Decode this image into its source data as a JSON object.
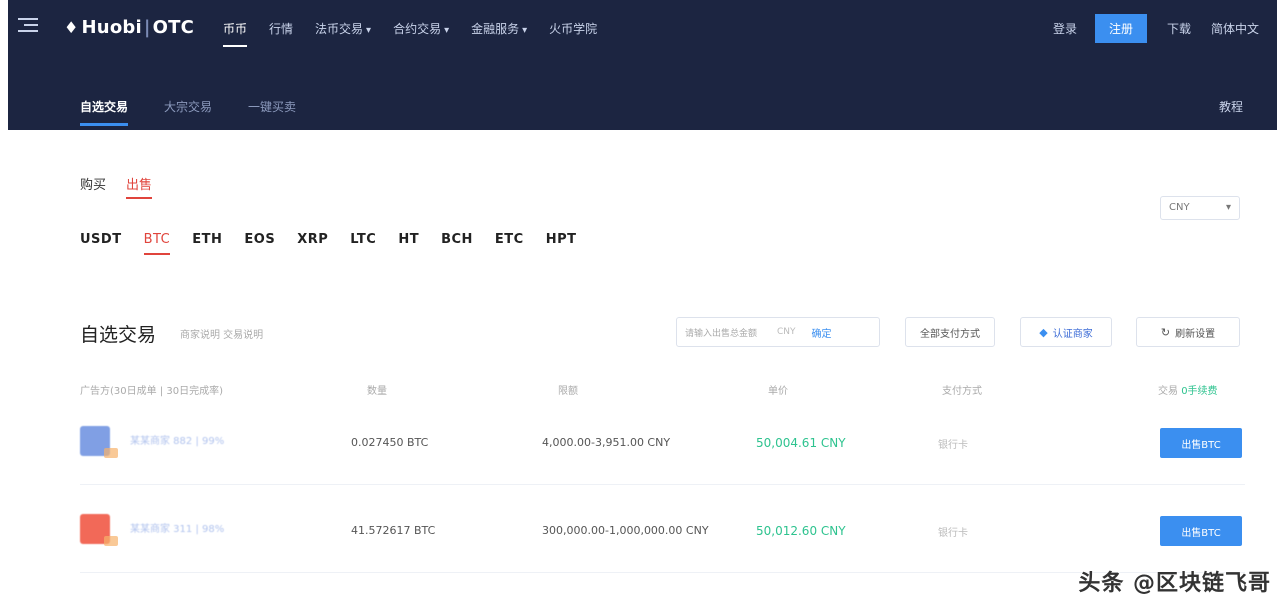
{
  "header": {
    "logo_main": "Huobi",
    "logo_sep": "|",
    "logo_sub": "OTC",
    "nav": [
      {
        "label": "币币",
        "caret": false,
        "active": true
      },
      {
        "label": "行情",
        "caret": false,
        "active": false
      },
      {
        "label": "法币交易",
        "caret": true,
        "active": false
      },
      {
        "label": "合约交易",
        "caret": true,
        "active": false
      },
      {
        "label": "金融服务",
        "caret": true,
        "active": false
      },
      {
        "label": "火币学院",
        "caret": false,
        "active": false
      }
    ],
    "login": "登录",
    "register": "注册",
    "download": "下载",
    "language": "简体中文",
    "subnav": [
      {
        "label": "自选交易",
        "active": true
      },
      {
        "label": "大宗交易",
        "active": false
      },
      {
        "label": "一键买卖",
        "active": false
      }
    ],
    "tutorial": "教程"
  },
  "side_tabs": [
    "购买",
    "出售"
  ],
  "active_side": 1,
  "coins": [
    "USDT",
    "BTC",
    "ETH",
    "EOS",
    "XRP",
    "LTC",
    "HT",
    "BCH",
    "ETC",
    "HPT"
  ],
  "active_coin": 1,
  "currency_select": {
    "value": "CNY",
    "caret": "▾"
  },
  "section": {
    "title": "自选交易",
    "subtitle": "商家说明  交易说明",
    "amount_placeholder": "请输入出售总金额",
    "amount_unit": "CNY",
    "amount_confirm": "确定",
    "payment_filter": "全部支付方式",
    "merchant_filter": "认证商家",
    "refresh": "刷新设置"
  },
  "table": {
    "headers": {
      "merchant": "广告方(30日成单 | 30日完成率)",
      "quantity": "数量",
      "limit": "限额",
      "price": "单价",
      "payment": "支付方式",
      "action": "交易",
      "action_hint": "0手续费"
    },
    "rows": [
      {
        "merchant": "某某商家 882 | 99%",
        "quantity": "0.027450 BTC",
        "limit": "4,000.00-3,951.00 CNY",
        "price": "50,004.61 CNY",
        "payment": "银行卡",
        "action": "出售BTC",
        "avatar_color": "#6a8fe0"
      },
      {
        "merchant": "某某商家 311 | 98%",
        "quantity": "41.572617 BTC",
        "limit": "300,000.00-1,000,000.00 CNY",
        "price": "50,012.60 CNY",
        "payment": "银行卡",
        "action": "出售BTC",
        "avatar_color": "#f0503c"
      }
    ]
  },
  "watermark": "头条 @区块链飞哥",
  "colors": {
    "header_bg": "#1c2541",
    "accent_blue": "#3b8ff0",
    "sell_red": "#e0443c",
    "price_green": "#2ec38f"
  }
}
